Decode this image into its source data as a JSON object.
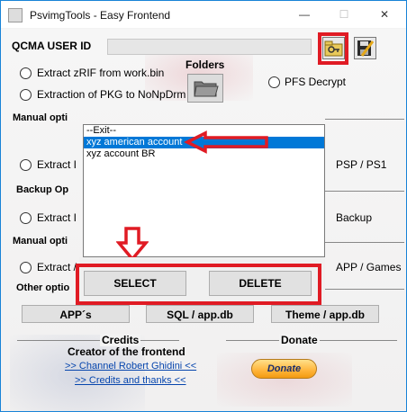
{
  "window": {
    "title": "PsvimgTools - Easy Frontend",
    "minimize": "—",
    "maximize": "☐",
    "close": "✕"
  },
  "header": {
    "user_id_label": "QCMA USER ID",
    "user_id_value": ""
  },
  "options": {
    "extract_zrif": "Extract zRIF from work.bin",
    "extract_pkg": "Extraction of PKG to NoNpDrm",
    "folders_label": "Folders",
    "pfs_decrypt": "PFS Decrypt"
  },
  "sections": {
    "manual_1": "Manual opti",
    "backup": "Backup Op",
    "manual_2": "Manual opti",
    "other": "Other optio"
  },
  "partial_rows": {
    "extract_1_left": "Extract I",
    "extract_1_right": "PSP / PS1",
    "extract_2_left": "Extract I",
    "extract_2_right": "Backup",
    "extract_3_left": "Extract /",
    "extract_3_right": "APP / Games"
  },
  "account_list": {
    "items": [
      "--Exit--",
      "xyz american account",
      "xyz account BR"
    ],
    "selected_index": 1,
    "select_button": "SELECT",
    "delete_button": "DELETE"
  },
  "bottom_buttons": {
    "apps": "APP´s",
    "sql": "SQL / app.db",
    "theme": "Theme / app.db"
  },
  "footer": {
    "credits_title": "Credits",
    "creator": "Creator of the frontend",
    "channel_link": ">> Channel Robert Ghidini <<",
    "credits_link": ">> Credits and thanks <<",
    "donate_title": "Donate",
    "donate_button": "Donate"
  },
  "annotation_color": "#e01b24",
  "selection_color": "#0078d7"
}
